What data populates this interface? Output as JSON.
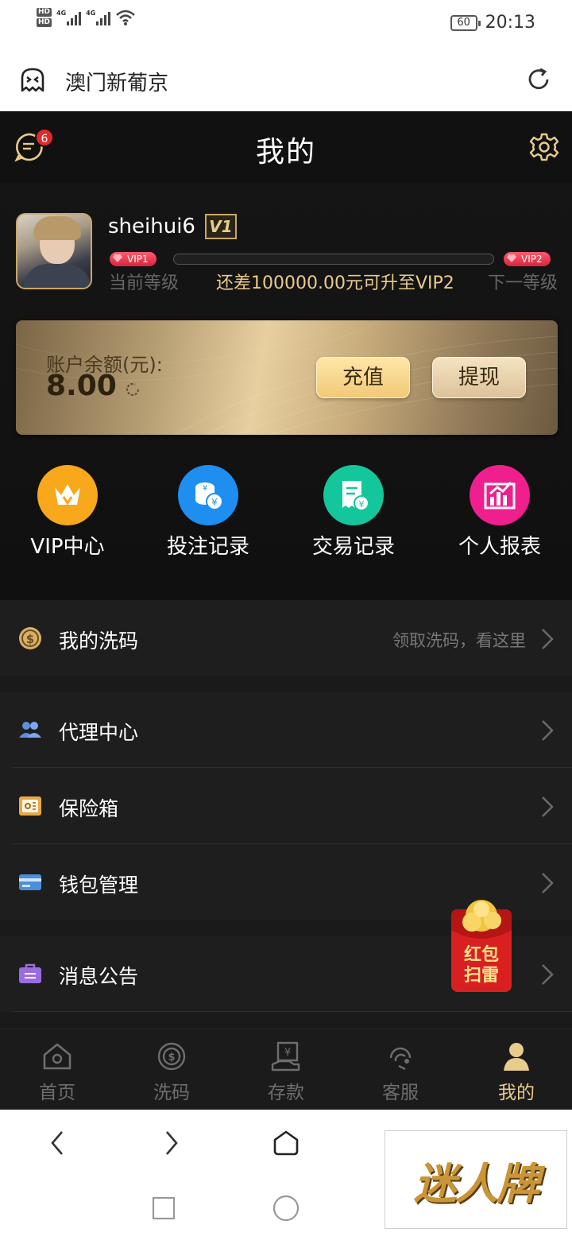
{
  "status_bar": {
    "hd1": "HD",
    "hd2": "HD",
    "net1": "4G",
    "net2": "4G",
    "battery": "60",
    "time": "20:13"
  },
  "browser": {
    "title": "澳门新葡京"
  },
  "header": {
    "title": "我的",
    "message_badge": "6"
  },
  "profile": {
    "username": "sheihui6",
    "vip_badge": "V1",
    "current_vip": "VIP1",
    "next_vip": "VIP2",
    "progress": 0.0,
    "current_level_label": "当前等级",
    "next_level_label": "下一等级",
    "upgrade_hint": "还差100000.00元可升至VIP2"
  },
  "balance": {
    "label": "账户余额(元):",
    "value": "8.00",
    "recharge_label": "充值",
    "withdraw_label": "提现"
  },
  "quick_actions": [
    {
      "label": "VIP中心",
      "icon": "crown-icon",
      "color": "#f7a81b"
    },
    {
      "label": "投注记录",
      "icon": "coins-icon",
      "color": "#1e8ff0"
    },
    {
      "label": "交易记录",
      "icon": "receipt-icon",
      "color": "#14c69c"
    },
    {
      "label": "个人报表",
      "icon": "chart-icon",
      "color": "#ef1f8e"
    }
  ],
  "menu": {
    "rebate": {
      "label": "我的洗码",
      "hint": "领取洗码，看这里"
    },
    "agent": {
      "label": "代理中心"
    },
    "safe": {
      "label": "保险箱"
    },
    "wallet": {
      "label": "钱包管理"
    },
    "notice": {
      "label": "消息公告"
    }
  },
  "red_packet": {
    "line1": "红包",
    "line2": "扫雷"
  },
  "tabs": [
    {
      "label": "首页",
      "icon": "home-icon"
    },
    {
      "label": "洗码",
      "icon": "target-icon"
    },
    {
      "label": "存款",
      "icon": "deposit-icon"
    },
    {
      "label": "客服",
      "icon": "support-icon"
    },
    {
      "label": "我的",
      "icon": "user-icon"
    }
  ],
  "watermark": {
    "text": "迷人牌"
  },
  "colors": {
    "gold": "#e8cc8b",
    "background": "#1a1a1a",
    "badge_red": "#e02a2a"
  }
}
